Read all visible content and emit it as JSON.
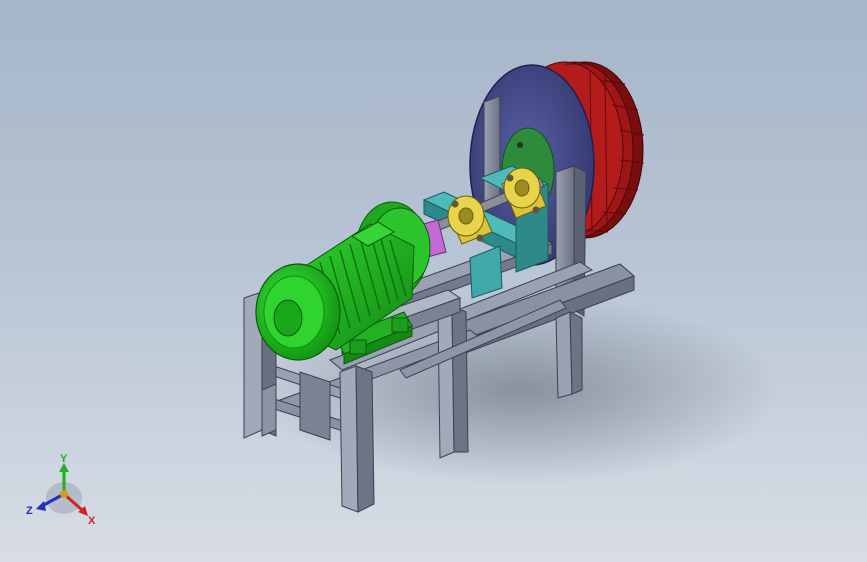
{
  "viewport": {
    "background_top": "#a6b5c9",
    "background_bottom": "#d8dde5"
  },
  "model": {
    "parts": [
      "steel-frame",
      "electric-motor",
      "shaft-coupling",
      "pillow-block-bearings",
      "drive-shaft",
      "flywheel-disc",
      "rim-wheel"
    ],
    "colors": {
      "frame": "#8f96a8",
      "motor": "#22c322",
      "coupling": "#c46ad6",
      "bearing": "#d9c43a",
      "mount_plate": "#3fa8a8",
      "disc": "#4b4f8f",
      "rim": "#a01616",
      "hub_plate": "#2e8b3c"
    }
  },
  "triad": {
    "x_label": "X",
    "y_label": "Y",
    "z_label": "Z",
    "x_color": "#d42020",
    "y_color": "#20b020",
    "z_color": "#2030c0"
  }
}
